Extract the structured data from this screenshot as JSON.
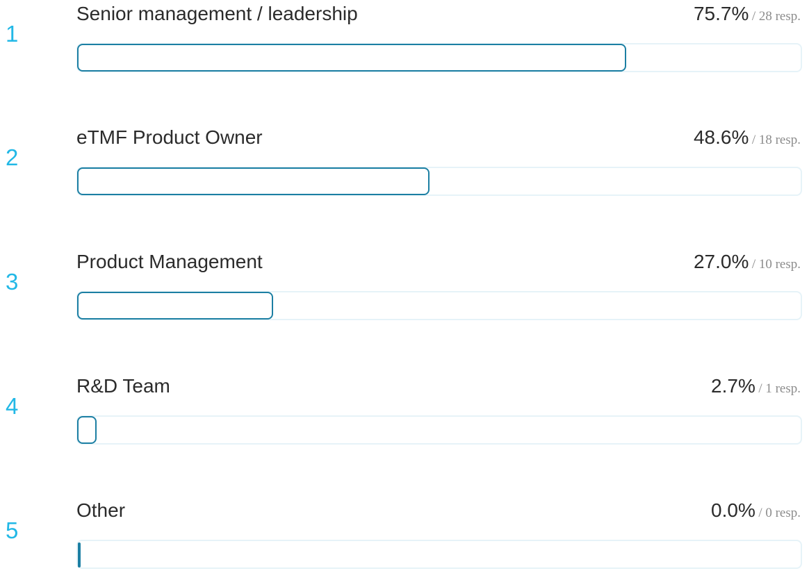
{
  "chart_data": {
    "type": "bar",
    "orientation": "horizontal",
    "categories": [
      "Senior management / leadership",
      "eTMF Product Owner",
      "Product Management",
      "R&D Team",
      "Other"
    ],
    "ranks": [
      "1",
      "2",
      "3",
      "4",
      "5"
    ],
    "values": [
      75.7,
      48.6,
      27.0,
      2.7,
      0.0
    ],
    "value_labels": [
      "75.7%",
      "48.6%",
      "27.0%",
      "2.7%",
      "0.0%"
    ],
    "responses": [
      28,
      18,
      10,
      1,
      0
    ],
    "response_labels": [
      "/ 28 resp.",
      "/ 18 resp.",
      "/ 10 resp.",
      "/ 1 resp.",
      "/ 0 resp."
    ],
    "xlim": [
      0,
      100
    ],
    "colors": {
      "rank": "#22b8e6",
      "bar_border": "#1c7fa3",
      "track_border": "#e6f3f8"
    }
  }
}
